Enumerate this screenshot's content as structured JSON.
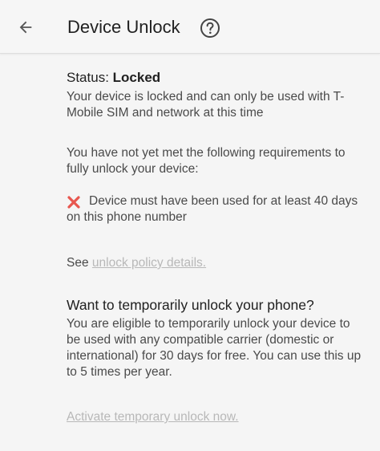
{
  "header": {
    "title": "Device Unlock"
  },
  "status": {
    "label": "Status:",
    "value": "Locked",
    "description": "Your device is locked and can only be used with T-Mobile SIM and network at this time"
  },
  "requirements": {
    "intro": "You have not yet met the following requirements to fully unlock your device:",
    "items": [
      {
        "icon": "red-x-icon",
        "text": "Device must have been used for at least 40 days on this phone number"
      }
    ]
  },
  "policy": {
    "prefix": "See",
    "link_text": "unlock policy details."
  },
  "temporary": {
    "heading": "Want to temporarily unlock your phone?",
    "description": "You are eligible to temporarily unlock your device to be used with any compatible carrier (domestic or international) for 30 days for free. You can use this up to 5 times per year.",
    "action_link": "Activate temporary unlock now."
  },
  "colors": {
    "background": "#f5f5f5",
    "error_red": "#e8574f",
    "disabled_link": "#b8b8b8"
  }
}
